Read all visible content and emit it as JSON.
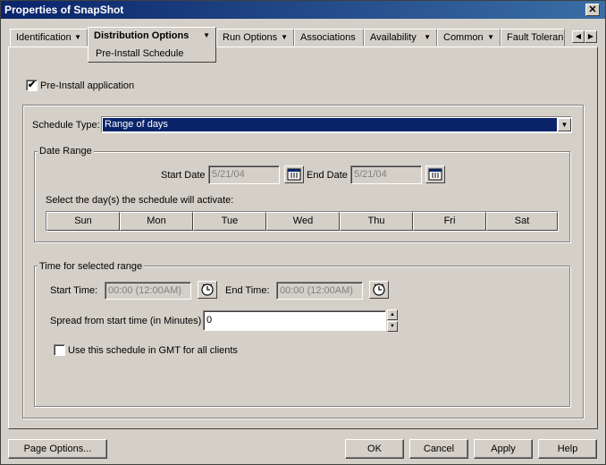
{
  "window": {
    "title": "Properties of SnapShot",
    "close": "✕"
  },
  "tabs": [
    {
      "label": "Identification"
    },
    {
      "label": "Distribution Options",
      "sub": "Pre-Install Schedule"
    },
    {
      "label": "Run Options"
    },
    {
      "label": "Associations"
    },
    {
      "label": "Availability"
    },
    {
      "label": "Common"
    },
    {
      "label": "Fault Toleran"
    }
  ],
  "tab_scroll": {
    "left": "◀",
    "right": "▶"
  },
  "preinstall": {
    "label": "Pre-Install application",
    "checked": "✔"
  },
  "schedule": {
    "type_label": "Schedule Type:",
    "type_value": "Range of days"
  },
  "date_range": {
    "legend": "Date Range",
    "start_label": "Start Date",
    "start_value": "5/21/04",
    "end_label": "End Date",
    "end_value": "5/21/04",
    "days_label": "Select the day(s) the schedule will activate:",
    "days": [
      "Sun",
      "Mon",
      "Tue",
      "Wed",
      "Thu",
      "Fri",
      "Sat"
    ]
  },
  "time_range": {
    "legend": "Time for selected range",
    "start_label": "Start Time:",
    "start_value": "00:00 (12:00AM)",
    "end_label": "End Time:",
    "end_value": "00:00 (12:00AM)",
    "spread_label": "Spread from start time (in Minutes)",
    "spread_value": "0",
    "gmt_label": "Use this schedule in GMT for all clients"
  },
  "buttons": {
    "page_options": "Page Options...",
    "ok": "OK",
    "cancel": "Cancel",
    "apply": "Apply",
    "help": "Help"
  },
  "colors": {
    "selection": "#0a246a",
    "face": "#d4d0c8",
    "title_start": "#0a246a",
    "title_end": "#3a6ea5"
  },
  "icons": {
    "calendar": "calendar-icon",
    "clock": "clock-icon",
    "dropdown": "dropdown-arrow-icon"
  }
}
